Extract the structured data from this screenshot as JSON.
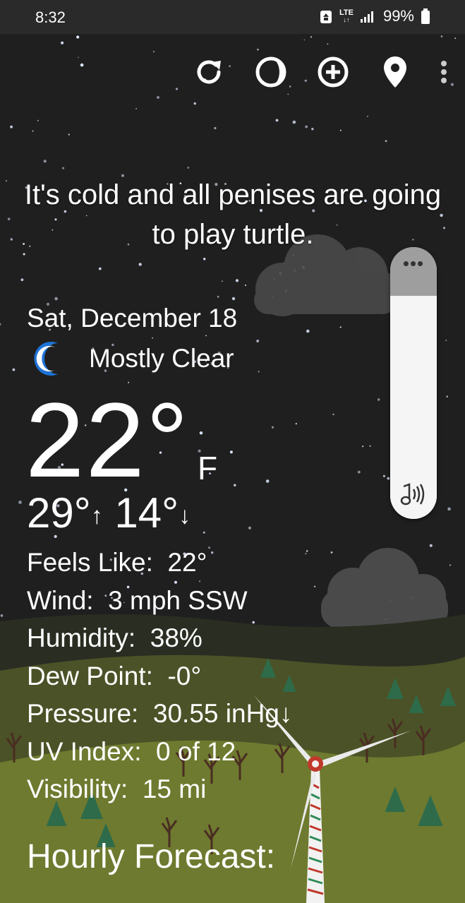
{
  "status_bar": {
    "time": "8:32",
    "network": "LTE",
    "battery": "99%"
  },
  "toolbar": {
    "refresh_icon": "refresh-icon",
    "moon_phase_icon": "moon-phase-icon",
    "add_location_icon": "add-circle-icon",
    "location_icon": "location-pin-icon",
    "more_icon": "more-vert-icon"
  },
  "headline": "It's cold and all penises are going to play turtle.",
  "current": {
    "date": "Sat, December 18",
    "condition_icon": "crescent-moon-icon",
    "condition": "Mostly Clear",
    "temperature": "22°",
    "unit": "F",
    "high": "29°",
    "low": "14°",
    "high_arrow": "↑",
    "low_arrow": "↓"
  },
  "details": [
    {
      "label": "Feels Like:",
      "value": "22°"
    },
    {
      "label": "Wind:",
      "value": "3 mph SSW"
    },
    {
      "label": "Humidity:",
      "value": "38%"
    },
    {
      "label": "Dew Point:",
      "value": "-0°"
    },
    {
      "label": "Pressure:",
      "value": "30.55 inHg↓"
    },
    {
      "label": "UV Index:",
      "value": "0 of 12"
    },
    {
      "label": "Visibility:",
      "value": "15 mi"
    }
  ],
  "hourly_title": "Hourly Forecast:",
  "volume_panel": {
    "level": 0.82,
    "more_icon": "more-horiz-icon",
    "media_icon": "music-note-icon"
  },
  "colors": {
    "sky": "#1e1e1e",
    "moon_blue": "#1e73d6",
    "hill_near": "#6f7a2c",
    "hill_far": "#3a4421",
    "tree_green": "#2e6b4a",
    "windmill_red": "#c0392b"
  }
}
